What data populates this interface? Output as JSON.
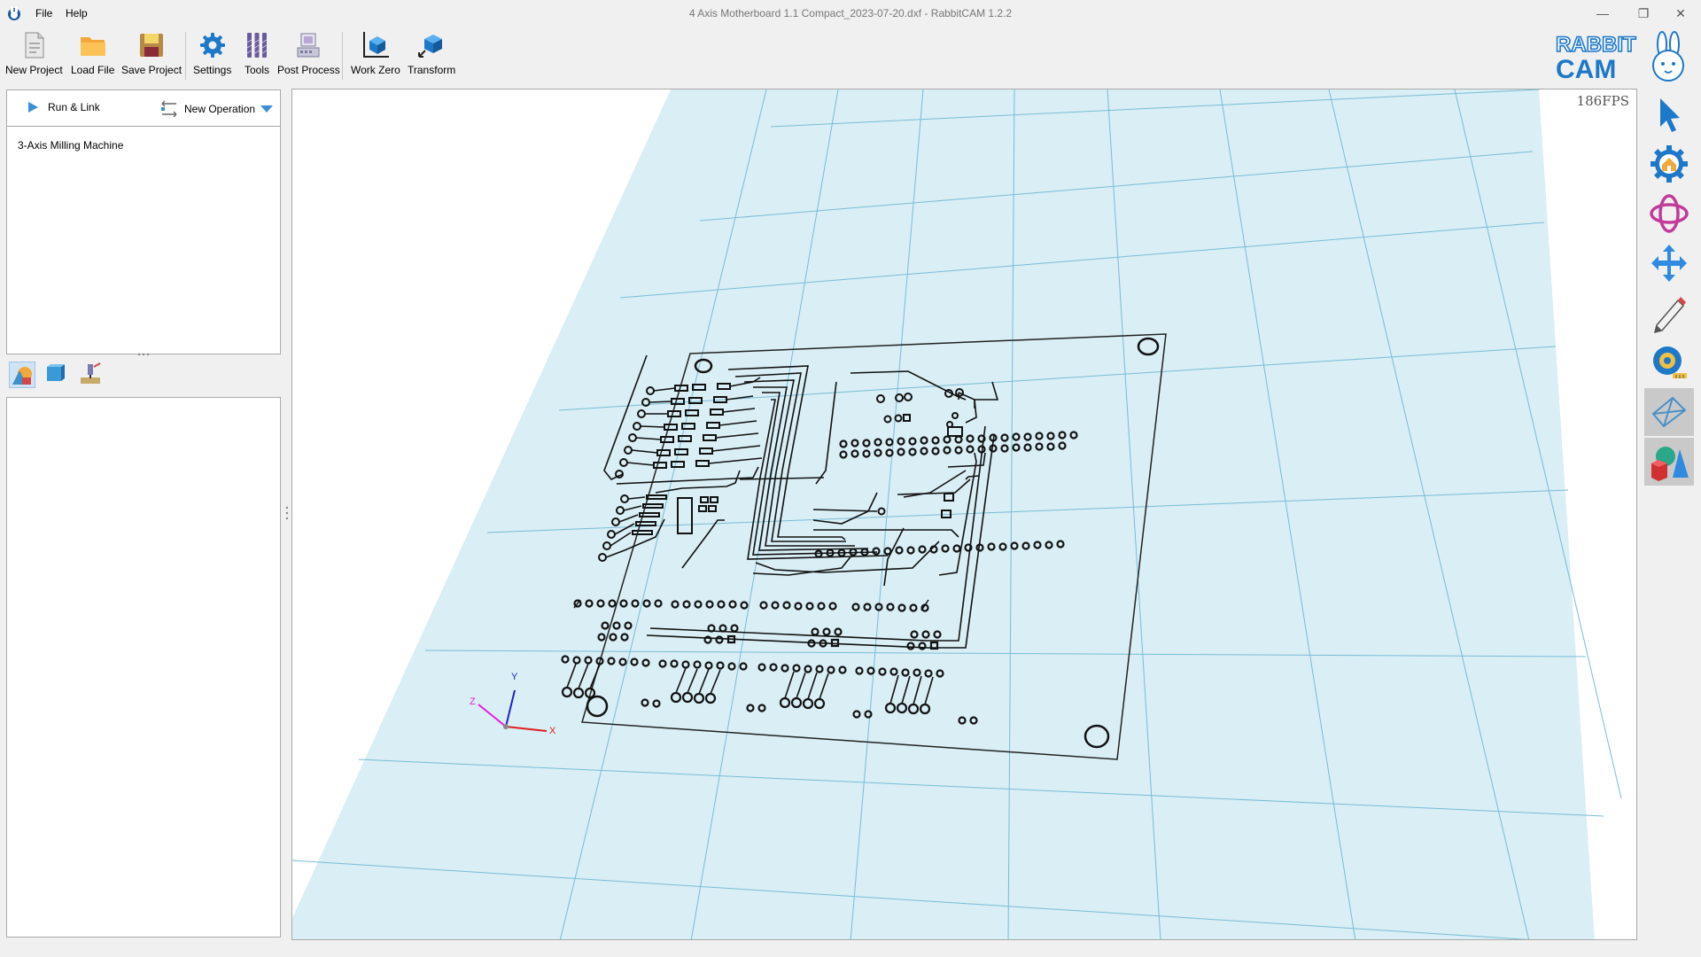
{
  "window": {
    "title": "4 Axis Motherboard 1.1 Compact_2023-07-20.dxf - RabbitCAM 1.2.2",
    "minimize": "—",
    "restore": "❐",
    "close": "✕"
  },
  "menu": {
    "file": "File",
    "help": "Help"
  },
  "toolbar": {
    "new_project": "New Project",
    "load_file": "Load File",
    "save_project": "Save Project",
    "settings": "Settings",
    "tools": "Tools",
    "post_process": "Post Process",
    "work_zero": "Work Zero",
    "transform": "Transform"
  },
  "logo": {
    "line1": "RABBIT",
    "line2": "CAM"
  },
  "operations": {
    "run_link": "Run & Link",
    "new_operation": "New Operation",
    "items": [
      "3-Axis Milling Machine"
    ]
  },
  "viewport": {
    "fps": "186FPS",
    "axis_x": "X",
    "axis_y": "Y",
    "axis_z": "Z"
  },
  "colors": {
    "grid_fill": "#d9eef5",
    "grid_line": "#79bcd6",
    "accent": "#1e78c8"
  },
  "right_tools": [
    "select-arrow-icon",
    "home-view-icon",
    "orbit-icon",
    "pan-icon",
    "sketch-pencil-icon",
    "measure-tape-icon",
    "wireframe-icon",
    "solid-shapes-icon"
  ]
}
